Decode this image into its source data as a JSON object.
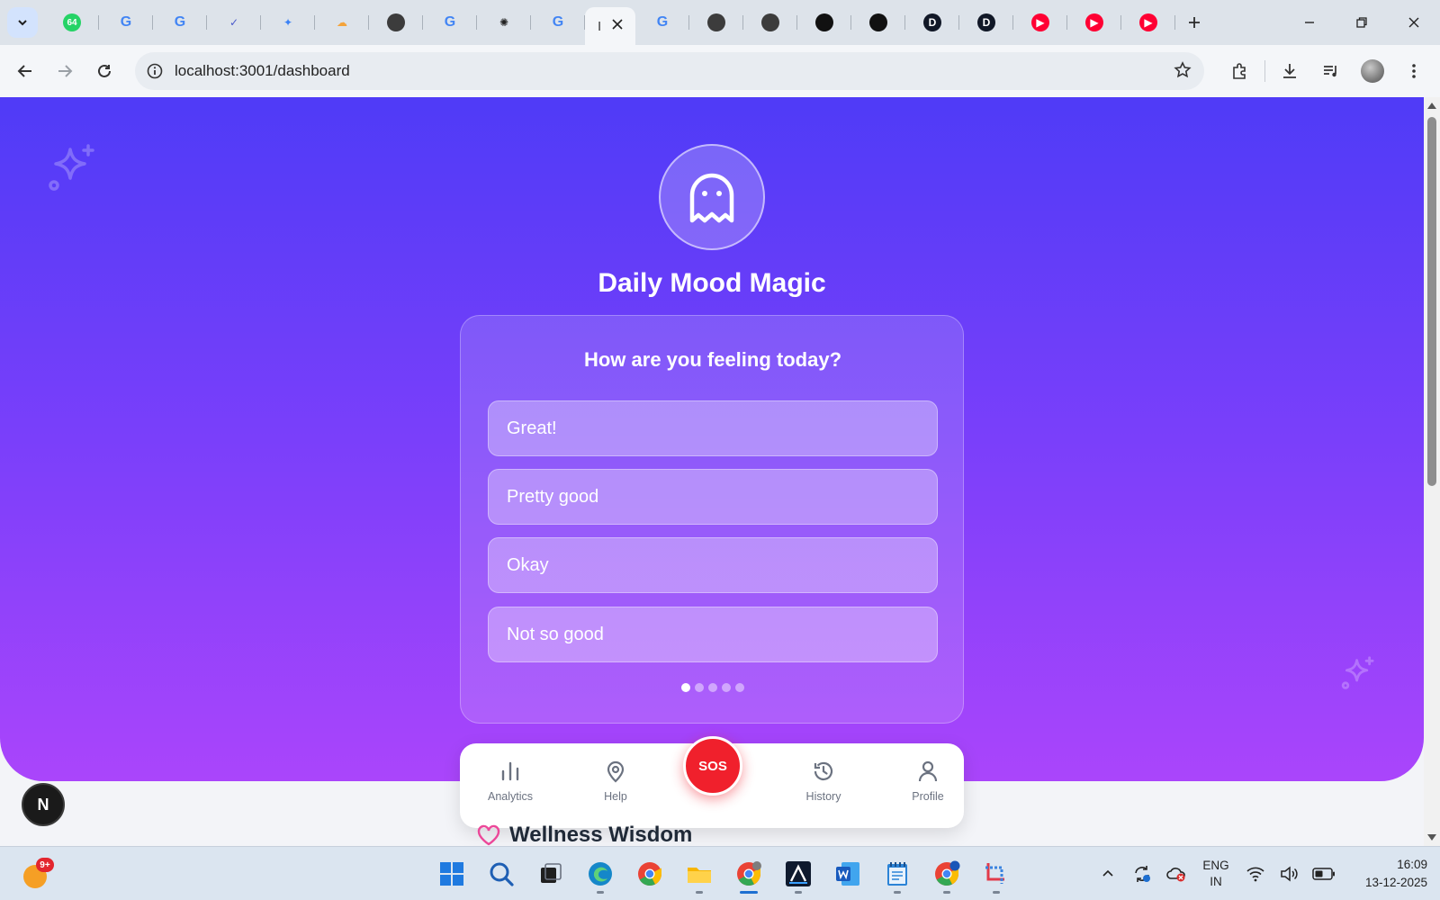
{
  "browser": {
    "tabs": [
      {
        "icon": "whatsapp-icon",
        "badge": "64",
        "color": "#25d366"
      },
      {
        "icon": "google-icon",
        "color": "#4285f4"
      },
      {
        "icon": "google-icon",
        "color": "#4285f4"
      },
      {
        "icon": "shield-check-icon",
        "color": "#4a5acb"
      },
      {
        "icon": "gemini-icon",
        "color": "#3b82f6"
      },
      {
        "icon": "cloud-icon",
        "color": "#f4a33a"
      },
      {
        "icon": "chrome-dark-icon",
        "color": "#3c3c3c"
      },
      {
        "icon": "google-icon",
        "color": "#4285f4"
      },
      {
        "icon": "openai-icon",
        "color": "#222222"
      },
      {
        "icon": "google-icon",
        "color": "#4285f4"
      },
      {
        "icon": "active-tab",
        "active": true
      },
      {
        "icon": "google-icon",
        "color": "#4285f4"
      },
      {
        "icon": "chrome-dark-icon",
        "color": "#3c3c3c"
      },
      {
        "icon": "chrome-dark-icon",
        "color": "#3c3c3c"
      },
      {
        "icon": "github-icon",
        "color": "#111111"
      },
      {
        "icon": "github-icon",
        "color": "#111111"
      },
      {
        "icon": "dev-d-icon",
        "color": "#111827"
      },
      {
        "icon": "dev-d-icon",
        "color": "#111827"
      },
      {
        "icon": "youtube-icon",
        "color": "#ff0033"
      },
      {
        "icon": "youtube-icon",
        "color": "#ff0033"
      },
      {
        "icon": "youtube-icon",
        "color": "#ff0033"
      }
    ],
    "active_tab_label": "l",
    "url": "localhost:3001/dashboard"
  },
  "page": {
    "title": "Daily Mood Magic",
    "question": "How are you feeling today?",
    "options": [
      "Great!",
      "Pretty good",
      "Okay",
      "Not so good"
    ],
    "dots_total": 5,
    "dots_active": 1,
    "nav": {
      "analytics": "Analytics",
      "help": "Help",
      "sos": "SOS",
      "history": "History",
      "profile": "Profile"
    },
    "section_title": "Wellness Wisdom",
    "dev_badge": "N",
    "colors": {
      "hero_top": "#4f3bf7",
      "hero_bottom": "#aa45fb",
      "sos": "#f0202c"
    }
  },
  "taskbar": {
    "weather_badge": "9+",
    "lang_line1": "ENG",
    "lang_line2": "IN",
    "time": "16:09",
    "date": "13-12-2025"
  }
}
